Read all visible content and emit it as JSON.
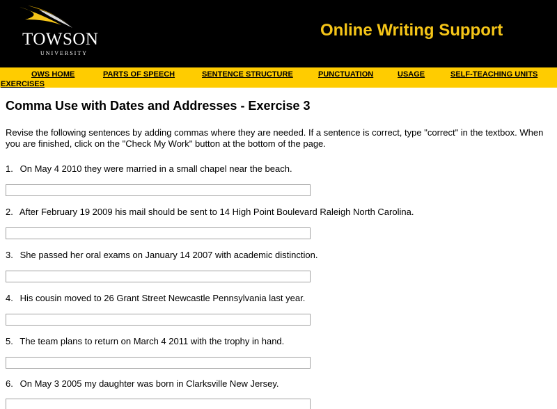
{
  "header": {
    "logo_name": "TOWSON",
    "logo_sub": "UNIVERSITY",
    "site_title": "Online Writing Support",
    "brand_color": "#ffcc00",
    "title_color": "#f5c518"
  },
  "nav": {
    "items": [
      {
        "label": "OWS HOME"
      },
      {
        "label": "PARTS OF SPEECH"
      },
      {
        "label": "SENTENCE STRUCTURE"
      },
      {
        "label": "PUNCTUATION"
      },
      {
        "label": "USAGE"
      },
      {
        "label": "SELF-TEACHING UNITS"
      },
      {
        "label": "EXERCISES"
      }
    ]
  },
  "main": {
    "title": "Comma Use with Dates and Addresses - Exercise 3",
    "intro": "Revise the following sentences by adding commas where they are needed. If a sentence is correct, type \"correct\" in the textbox. When you are finished, click on the \"Check My Work\" button at the bottom of the page.",
    "questions": [
      {
        "number": "1.",
        "text": "On May 4 2010 they were married in a small chapel near the beach.",
        "answer": ""
      },
      {
        "number": "2.",
        "text": "After February 19 2009 his mail should be sent to 14 High Point Boulevard Raleigh North Carolina.",
        "answer": ""
      },
      {
        "number": "3.",
        "text": "She passed her oral exams on January 14 2007 with academic distinction.",
        "answer": ""
      },
      {
        "number": "4.",
        "text": "His cousin moved to 26 Grant Street Newcastle Pennsylvania last year.",
        "answer": ""
      },
      {
        "number": "5.",
        "text": "The team plans to return on March 4 2011 with the trophy in hand.",
        "answer": ""
      },
      {
        "number": "6.",
        "text": "On May 3 2005 my daughter was born in Clarksville New Jersey.",
        "answer": ""
      }
    ]
  }
}
